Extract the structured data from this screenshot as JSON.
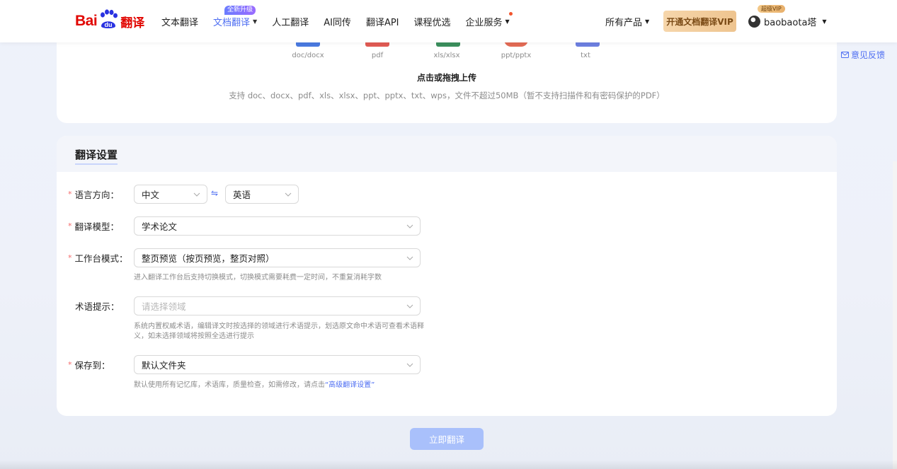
{
  "header": {
    "logo_bai": "Bai",
    "logo_du": "du",
    "logo_fanyi": "翻译",
    "nav": [
      {
        "label": "文本翻译",
        "active": false,
        "caret": false
      },
      {
        "label": "文档翻译",
        "active": true,
        "caret": true,
        "badge": "全新升级"
      },
      {
        "label": "人工翻译",
        "active": false,
        "caret": false
      },
      {
        "label": "AI同传",
        "active": false,
        "caret": false
      },
      {
        "label": "翻译API",
        "active": false,
        "caret": false
      },
      {
        "label": "课程优选",
        "active": false,
        "caret": false
      },
      {
        "label": "企业服务",
        "active": false,
        "caret": true,
        "dot": true
      }
    ],
    "all_products": "所有产品",
    "vip_button": "开通文档翻译VIP",
    "vip_badge": "超级VIP",
    "username": "baobaota塔"
  },
  "feedback": "意见反馈",
  "upload": {
    "file_types": [
      "doc/docx",
      "pdf",
      "xls/xlsx",
      "ppt/pptx",
      "txt"
    ],
    "title": "点击或拖拽上传",
    "description": "支持 doc、docx、pdf、xls、xlsx、ppt、pptx、txt、wps，文件不超过50MB（暂不支持扫描件和有密码保护的PDF）"
  },
  "settings": {
    "title": "翻译设置",
    "language": {
      "label": "语言方向：",
      "source": "中文",
      "target": "英语",
      "swap": "⇋"
    },
    "model": {
      "label": "翻译模型：",
      "value": "学术论文"
    },
    "workspace": {
      "label": "工作台模式：",
      "value": "整页预览（按页预览，整页对照）",
      "hint": "进入翻译工作台后支持切换模式，切换模式需要耗费一定时间，不重复消耗字数"
    },
    "terminology": {
      "label": "术语提示：",
      "placeholder": "请选择领域",
      "hint": "系统内置权威术语，编辑译文时按选择的领域进行术语提示，划选原文命中术语可查看术语释义，如未选择领域将按照全选进行提示"
    },
    "save_to": {
      "label": "保存到：",
      "value": "默认文件夹",
      "hint_prefix": "默认使用所有记忆库，术语库，质量检查，如需修改，请点击",
      "hint_link": "“高级翻译设置”"
    }
  },
  "submit": "立即翻译",
  "colors": {
    "brand_red": "#e10601",
    "accent_blue": "#4e6ef2",
    "submit_disabled": "#a9c0fb"
  }
}
